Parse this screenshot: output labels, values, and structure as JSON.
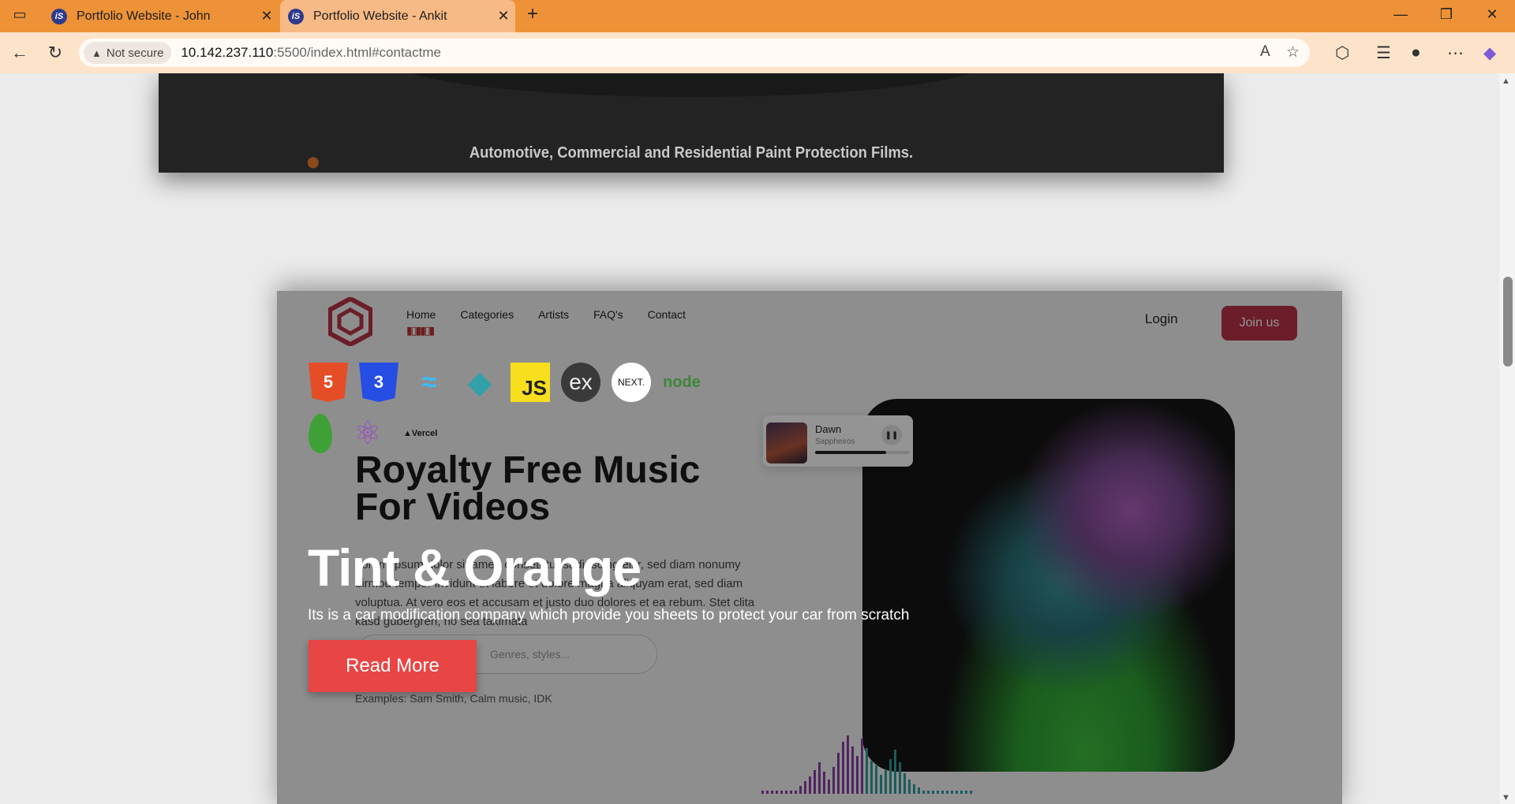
{
  "browser": {
    "tabs": [
      {
        "label": "Portfolio Website - John",
        "favicon": "iS",
        "active": false
      },
      {
        "label": "Portfolio Website - Ankit",
        "favicon": "iS",
        "active": true
      }
    ],
    "security_label": "Not secure",
    "url_host": "10.142.237.110",
    "url_rest": ":5500/index.html#contactme",
    "accent_color": "#ee9238"
  },
  "project1": {
    "tagline": "Automotive, Commercial and Residential Paint Protection Films."
  },
  "project2": {
    "nav": [
      "Home",
      "Categories",
      "Artists",
      "FAQ's",
      "Contact"
    ],
    "login_label": "Login",
    "join_label": "Join us",
    "hero_title": "Royalty Free Music For Videos",
    "hero_paragraph": "Lorem ipsum dolor sit amet, consetetur sadipscing elitr, sed diam nonumy eirmod tempor invidunt ut labore et dolore magna aliquyam erat, sed diam voluptua. At vero eos et accusam et justo duo dolores et ea rebum. Stet clita kasd gubergren, no sea takimata",
    "search_placeholder": "Genres, styles...",
    "examples": "Examples: Sam Smith, Calm music, IDK",
    "player": {
      "song": "Dawn",
      "artist": "Sappheiros",
      "progress": 0.75
    },
    "brand_color": "#b83447"
  },
  "overlay": {
    "tech_icons": [
      "html5-icon",
      "css3-icon",
      "tailwind-icon",
      "netlify-icon",
      "javascript-icon",
      "express-icon",
      "nextjs-icon",
      "nodejs-icon",
      "mongodb-icon",
      "graphql-icon",
      "vercel-icon"
    ],
    "js_label": "JS",
    "express_label": "ex",
    "next_label": "NEXT.",
    "node_label": "node",
    "vercel_label": "Vercel",
    "title": "Tint & Orange",
    "description": "Its is a car modification company which provide you sheets to protect your car from scratch",
    "read_more_label": "Read More",
    "button_color": "#e84545"
  }
}
